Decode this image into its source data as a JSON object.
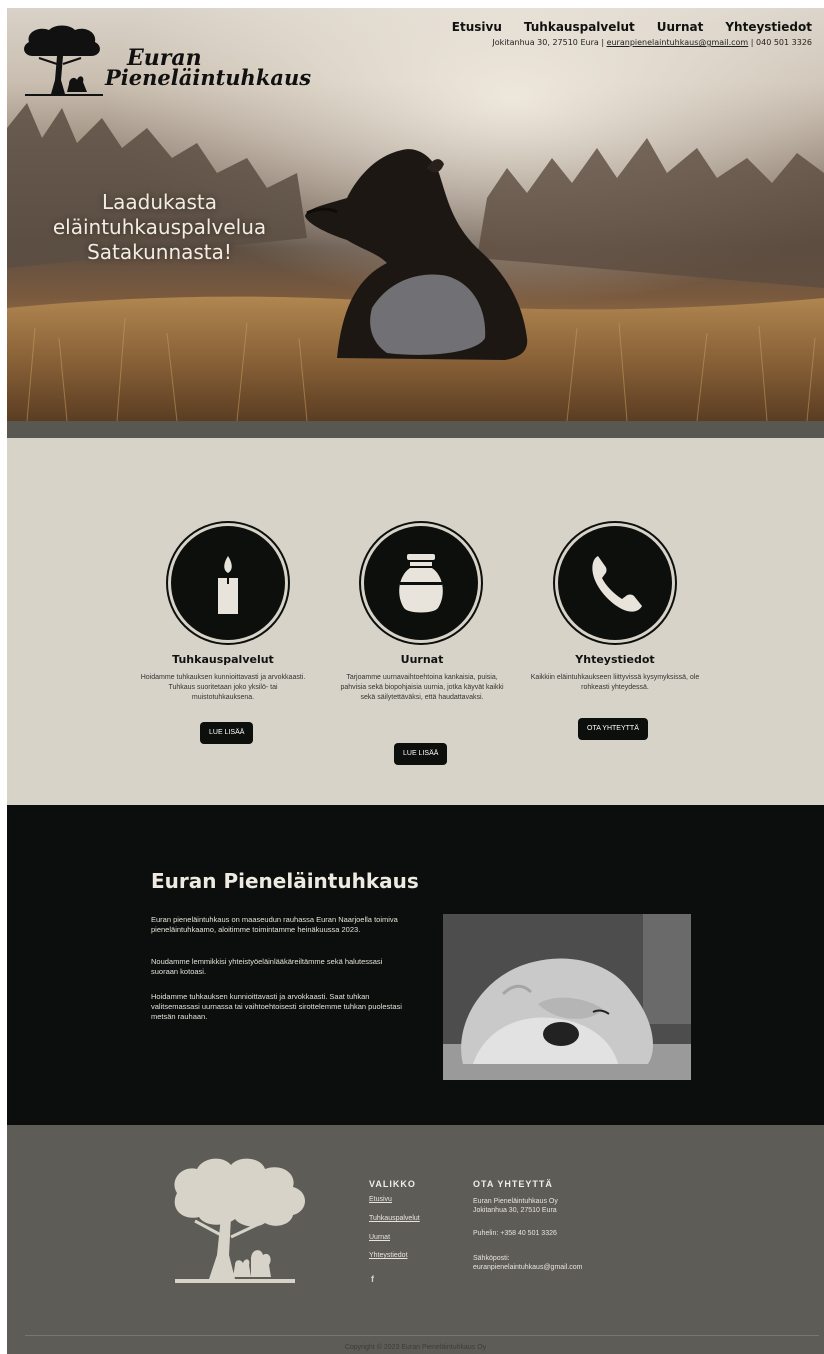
{
  "brand": {
    "logo_line1": "Euran",
    "logo_line2": "Pieneläintuhkaus"
  },
  "nav": {
    "items": [
      "Etusivu",
      "Tuhkauspalvelut",
      "Uurnat",
      "Yhteystiedot"
    ]
  },
  "header_contact": {
    "address": "Jokitanhua 30, 27510 Eura",
    "separator": "|",
    "email": "euranpienelaintuhkaus@gmail.com",
    "phone": "040 501 3326"
  },
  "hero": {
    "tagline_line1": "Laadukasta",
    "tagline_line2": "eläintuhkauspalvelua",
    "tagline_line3": "Satakunnasta!"
  },
  "services": [
    {
      "icon": "candle-icon",
      "title": "Tuhkauspalvelut",
      "text": "Hoidamme tuhkauksen kunnioittavasti ja arvokkaasti. Tuhkaus suoritetaan joko yksilö- tai muistotuhkauksena.",
      "button": "LUE LISÄÄ"
    },
    {
      "icon": "urn-icon",
      "title": "Uurnat",
      "text": "Tarjoamme uurnavaihtoehtoina kankaisia, puisia, pahvisia sekä biopohjaisia uurnia, jotka käyvät kaikki sekä säilytettäväksi, että haudattavaksi.",
      "button": "LUE LISÄÄ"
    },
    {
      "icon": "phone-icon",
      "title": "Yhteystiedot",
      "text": "Kaikkiin eläintuhkaukseen liittyvissä kysymyksissä, ole rohkeasti yhteydessä.",
      "button": "OTA YHTEYTTÄ"
    }
  ],
  "about": {
    "title": "Euran Pieneläintuhkaus",
    "paragraphs": [
      "Euran pieneläintuhkaus on maaseudun rauhassa Euran Naarjoella toimiva pieneläintuhkaamo, aloitimme toimintamme heinäkuussa 2023.",
      "Noudamme lemmikkisi yhteistyöeläinlääkäreiltämme sekä halutessasi suoraan kotoasi.",
      "Hoidamme tuhkauksen kunnioittavasti ja arvokkaasti. Saat tuhkan valitsemassasi uurnassa tai vaihtoehtoisesti sirottelemme tuhkan puolestasi metsän rauhaan."
    ]
  },
  "footer": {
    "menu_heading": "VALIKKO",
    "menu_items": [
      "Etusivu",
      "Tuhkauspalvelut",
      "Uurnat",
      "Yhteystiedot"
    ],
    "social_icon": "facebook-icon",
    "social_glyph": "f",
    "contact_heading": "OTA YHTEYTTÄ",
    "company": "Euran Pieneläintuhkaus Oy",
    "address": "Jokitanhua 30, 27510 Eura",
    "phone": "Puhelin: +358 40 501 3326",
    "email_label": "Sähköposti:",
    "email": "euranpienelaintuhkaus@gmail.com",
    "copyright": "Copyright © 2023 Euran Pieneläintuhkaus Oy"
  },
  "colors": {
    "services_bg": "#d8d3c8",
    "about_bg": "#0b0e0c",
    "footer_bg": "#5d5c57",
    "button_bg": "#0d0f0d"
  }
}
